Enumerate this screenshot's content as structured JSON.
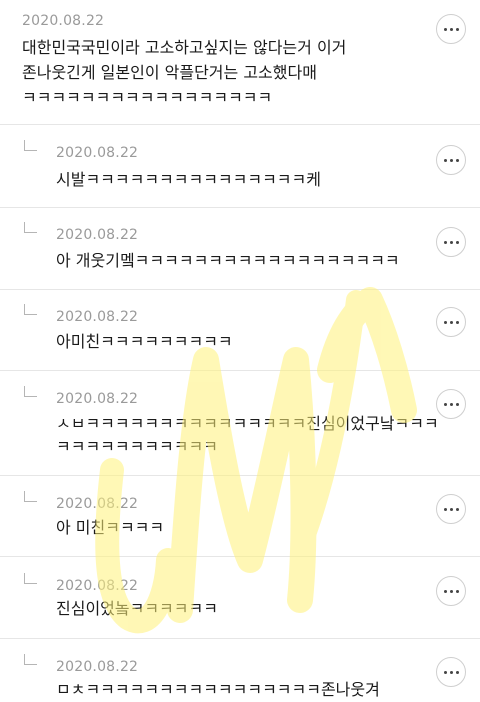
{
  "comments": [
    {
      "date": "2020.08.22",
      "lines": [
        "대한민국국민이라 고소하고싶지는 않다는거 이거",
        "존나웃긴게 일본인이 악플단거는 고소했다매",
        "ㅋㅋㅋㅋㅋㅋㅋㅋㅋㅋㅋㅋㅋㅋㅋㅋㅋ"
      ],
      "is_reply": false
    },
    {
      "date": "2020.08.22",
      "lines": [
        "시발ㅋㅋㅋㅋㅋㅋㅋㅋㅋㅋㅋㅋㅋㅋㅋ케"
      ],
      "is_reply": true
    },
    {
      "date": "2020.08.22",
      "lines": [
        "아 개웃기멬ㅋㅋㅋㅋㅋㅋㅋㅋㅋㅋㅋㅋㅋㅋㅋㅋㅋㅋ"
      ],
      "is_reply": true
    },
    {
      "date": "2020.08.22",
      "lines": [
        "아미친ㅋㅋㅋㅋㅋㅋㅋㅋㅋ"
      ],
      "is_reply": true
    },
    {
      "date": "2020.08.22",
      "lines": [
        "ㅅㅂㅋㅋㅋㅋㅋㅋㅋㅋㅋㅋㅋㅋㅋㅋㅋ진심이었구낰ㅋㅋㅋ",
        "ㅋㅋㅋㅋㅋㅋㅋㅋㅋㅋㅋ"
      ],
      "is_reply": true
    },
    {
      "date": "2020.08.22",
      "lines": [
        "아 미친ㅋㅋㅋㅋ"
      ],
      "is_reply": true
    },
    {
      "date": "2020.08.22",
      "lines": [
        "진심이었놐ㅋㅋㅋㅋㅋㅋ"
      ],
      "is_reply": true
    },
    {
      "date": "2020.08.22",
      "lines": [
        "ㅁㅊㅋㅋㅋㅋㅋㅋㅋㅋㅋㅋㅋㅋㅋㅋㅋㅋ존나웃겨"
      ],
      "is_reply": true
    }
  ],
  "more_icon": "more-horizontal-icon",
  "reply_icon": "reply-arrow-icon",
  "watermark_color": "#fff27a"
}
